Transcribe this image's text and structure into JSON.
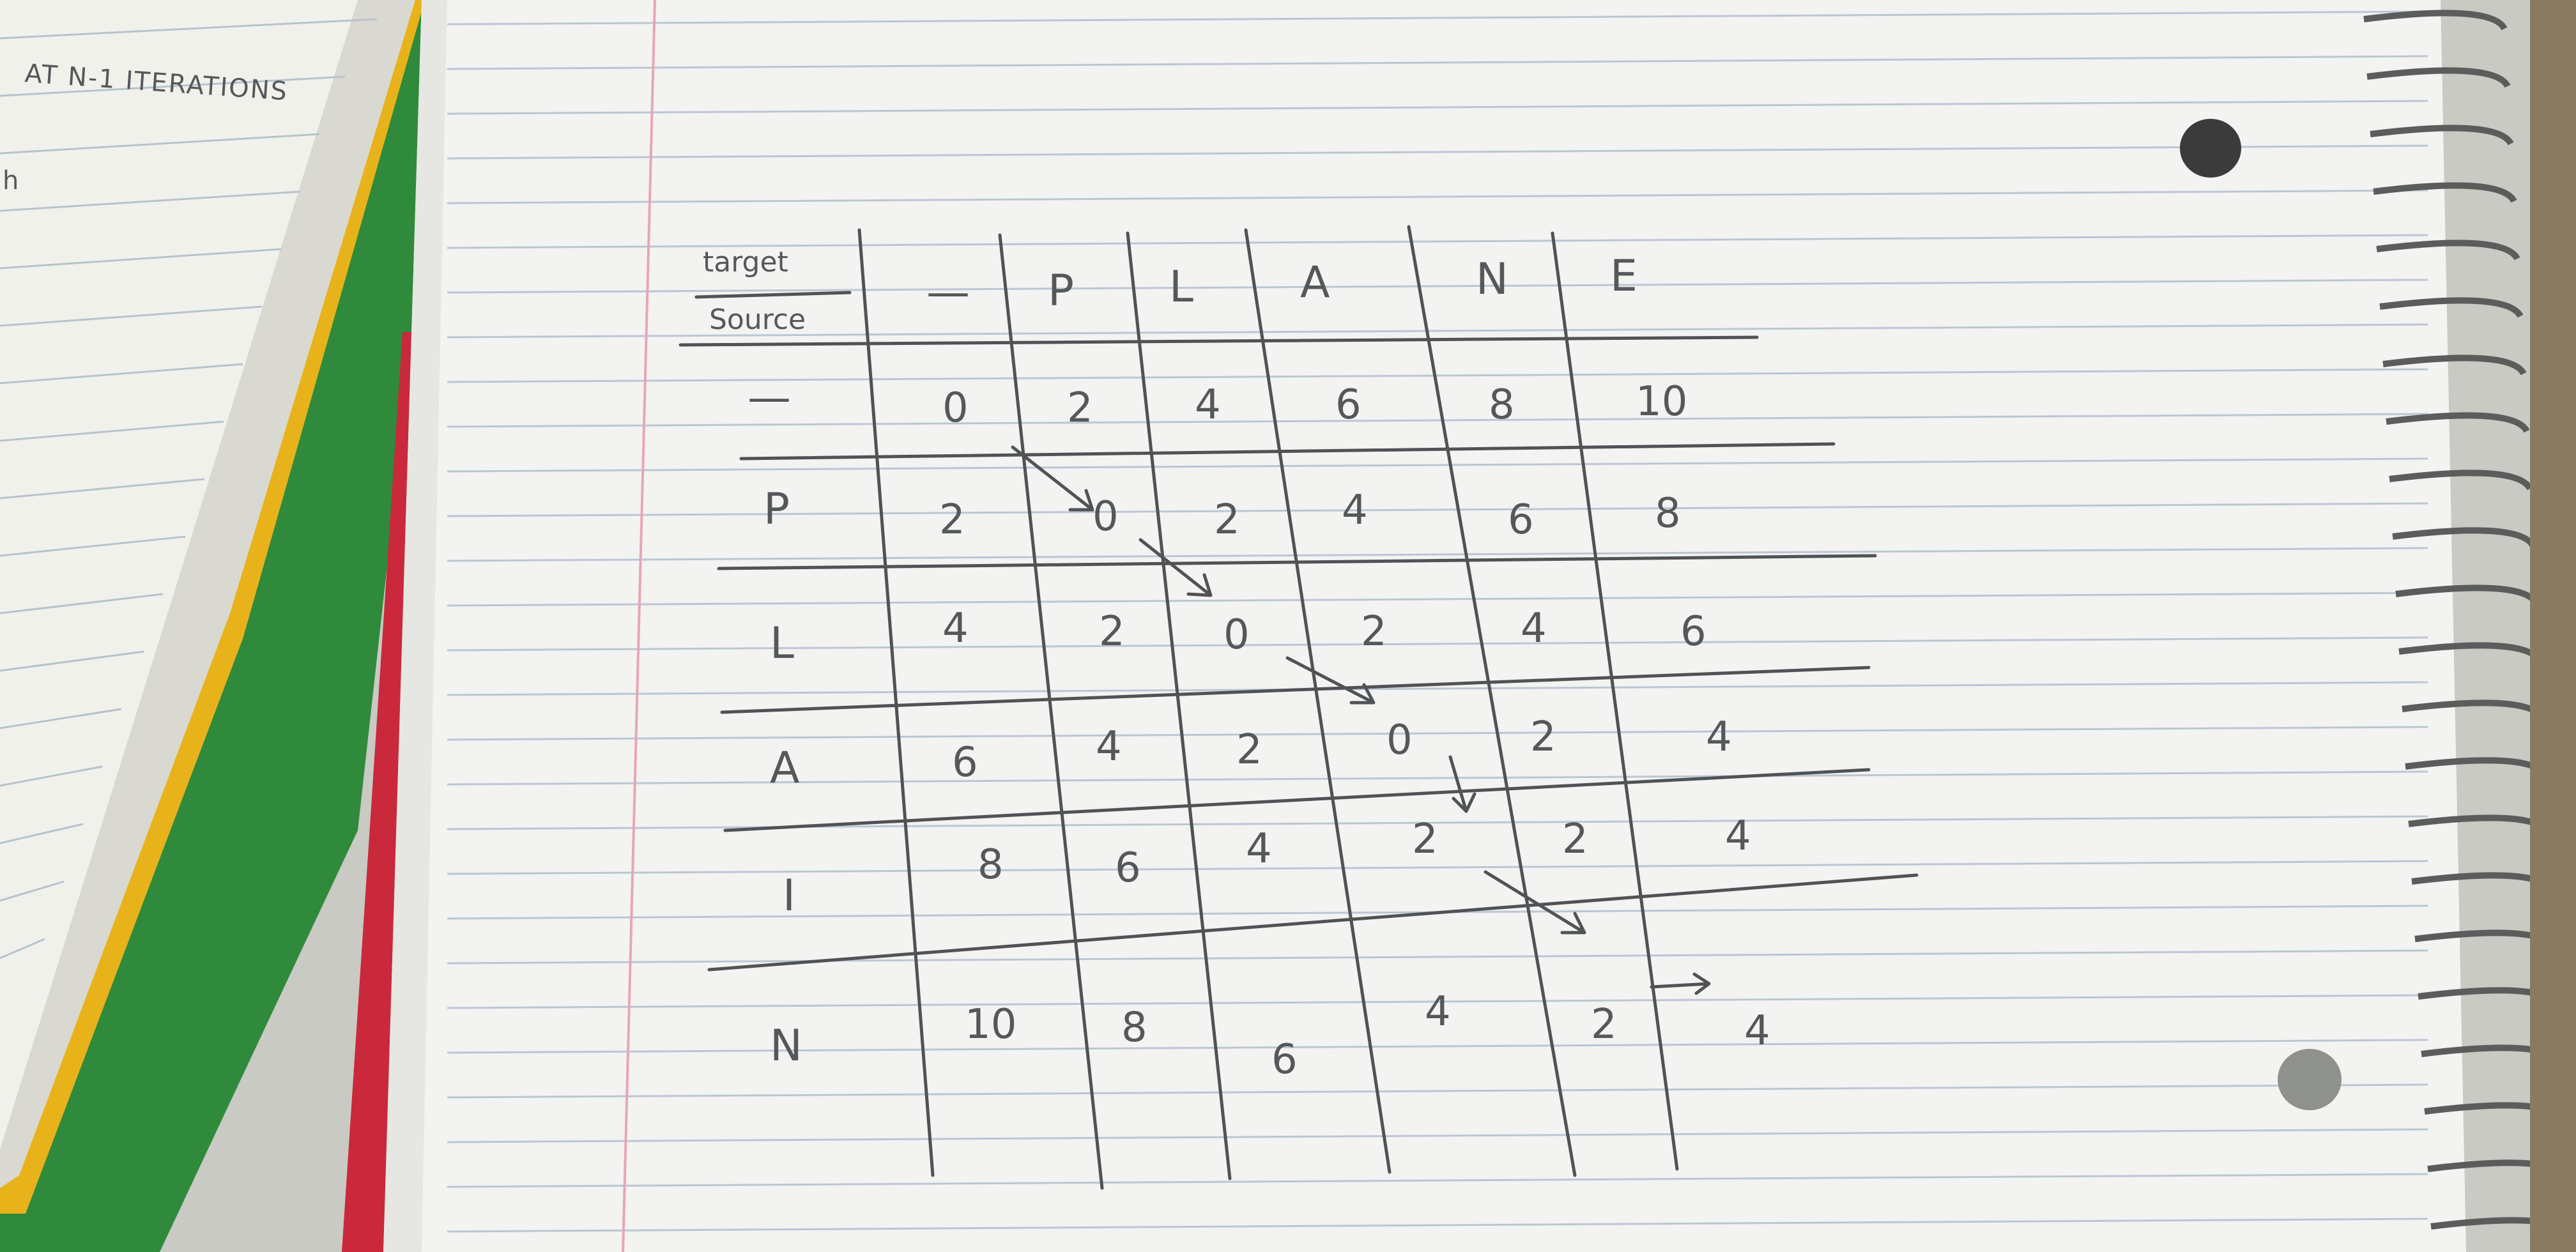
{
  "left_notebook": {
    "note": "AT N-1 ITERATIONS",
    "stray_mark": "h"
  },
  "table": {
    "corner_top": "target",
    "corner_bottom": "Source",
    "columns": [
      "—",
      "P",
      "L",
      "A",
      "N",
      "E"
    ],
    "rows": [
      {
        "label": "—",
        "values": [
          "0",
          "2",
          "4",
          "6",
          "8",
          "10"
        ]
      },
      {
        "label": "P",
        "values": [
          "2",
          "0",
          "2",
          "4",
          "6",
          "8"
        ]
      },
      {
        "label": "L",
        "values": [
          "4",
          "2",
          "0",
          "2",
          "4",
          "6"
        ]
      },
      {
        "label": "A",
        "values": [
          "6",
          "4",
          "2",
          "0",
          "2",
          "4"
        ]
      },
      {
        "label": "I",
        "values": [
          "8",
          "6",
          "4",
          "2",
          "2",
          "4"
        ]
      },
      {
        "label": "N",
        "values": [
          "10",
          "8",
          "6",
          "4",
          "2",
          "4"
        ]
      }
    ]
  },
  "colors": {
    "paper": "#f3f3f1",
    "rule_line": "#bcc6d4",
    "margin_line": "#e8a6b4",
    "ink": "#55585a",
    "binder_green": "#2f8a3c",
    "binder_red": "#c9293a",
    "binder_yellow": "#e8b21b"
  }
}
